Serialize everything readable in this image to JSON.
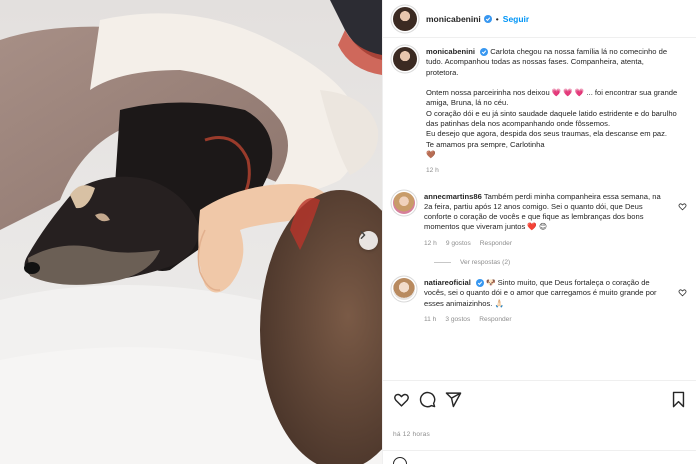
{
  "post": {
    "username": "monicabenini",
    "follow_label": "Seguir",
    "separator": "•",
    "caption": [
      "Carlota chegou na nossa família lá no comecinho de tudo. Acompanhou todas as nossas fases. Companheira, atenta, protetora.",
      "",
      "Ontem nossa parceirinha nos deixou 💗 💗 💗 ... foi encontrar sua grande amiga, Bruna, lá no céu.",
      "O coração dói e eu já sinto saudade daquele latido estridente e do barulho das patinhas dela nos acompanhando onde fôssemos.",
      "Eu desejo que agora, despida dos seus traumas, ela descanse em paz.",
      "Te amamos pra sempre, Carlotinha",
      "🤎"
    ],
    "caption_time": "12 h",
    "posted_ago": "há 12 horas"
  },
  "comments": [
    {
      "username": "annecmartins86",
      "text": "Também perdi minha companheira essa semana, na 2a feira, partiu após 12 anos comigo. Sei o quanto dói, que Deus conforte o coração de vocês e que fique as lembranças dos bons momentos que viveram juntos ❤️ 😊",
      "time": "12 h",
      "likes": "9 gostos",
      "reply_label": "Responder",
      "view_replies": "Ver respostas (2)"
    },
    {
      "username": "natiareoficial",
      "text": "🐶 Sinto muito, que Deus fortaleça o coração de vocês, sei o quanto dói e o amor que carregamos é muito grande por esses animaizinhos. 🙏🏻",
      "time": "11 h",
      "likes": "3 gostos",
      "reply_label": "Responder"
    }
  ],
  "icons": {
    "like": "heart-icon",
    "comment": "comment-icon",
    "share": "paper-plane-icon",
    "save": "bookmark-icon",
    "carousel_next": "chevron-right-icon",
    "verified": "verified-badge-icon"
  },
  "colors": {
    "accent": "#0095f6",
    "verified": "#3897f0",
    "muted_text": "#8e8e8e",
    "text": "#262626"
  }
}
